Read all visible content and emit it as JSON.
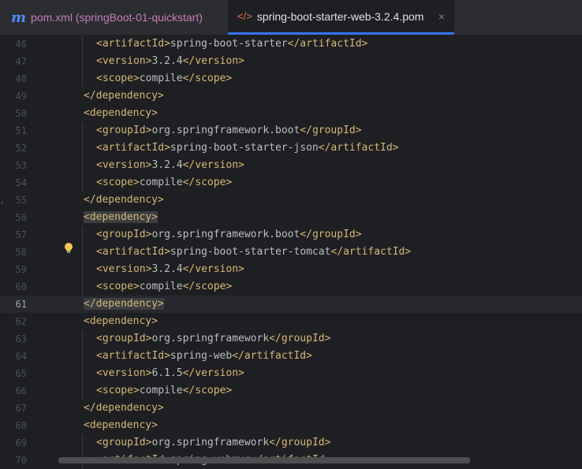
{
  "tabs": [
    {
      "label": "pom.xml (springBoot-01-quickstart)",
      "icon": "m-maven-icon",
      "active": false
    },
    {
      "label": "spring-boot-starter-web-3.2.4.pom",
      "icon": "xml-code-icon",
      "active": true
    }
  ],
  "tab_icons": {
    "maven": "m",
    "xml": "</>",
    "close": "×"
  },
  "editor": {
    "current_line": 61,
    "lines": [
      {
        "n": "46",
        "open": "<artifactId>",
        "text": "spring-boot-starter",
        "close": "</artifactId>"
      },
      {
        "n": "47",
        "open": "<version>",
        "text": "3.2.4",
        "close": "</version>"
      },
      {
        "n": "48",
        "open": "<scope>",
        "text": "compile",
        "close": "</scope>"
      },
      {
        "n": "49",
        "open": "",
        "text": "</dependency>",
        "close": ""
      },
      {
        "n": "50",
        "open": "",
        "text": "<dependency>",
        "close": ""
      },
      {
        "n": "51",
        "open": "<groupId>",
        "text": "org.springframework.boot",
        "close": "</groupId>"
      },
      {
        "n": "52",
        "open": "<artifactId>",
        "text": "spring-boot-starter-json",
        "close": "</artifactId>"
      },
      {
        "n": "53",
        "open": "<version>",
        "text": "3.2.4",
        "close": "</version>"
      },
      {
        "n": "54",
        "open": "<scope>",
        "text": "compile",
        "close": "</scope>"
      },
      {
        "n": "55",
        "open": "",
        "text": "</dependency>",
        "close": ""
      },
      {
        "n": "56",
        "open": "",
        "text": "<dependency>",
        "close": ""
      },
      {
        "n": "57",
        "open": "<groupId>",
        "text": "org.springframework.boot",
        "close": "</groupId>"
      },
      {
        "n": "58",
        "open": "<artifactId>",
        "text": "spring-boot-starter-tomcat",
        "close": "</artifactId>"
      },
      {
        "n": "59",
        "open": "<version>",
        "text": "3.2.4",
        "close": "</version>"
      },
      {
        "n": "60",
        "open": "<scope>",
        "text": "compile",
        "close": "</scope>"
      },
      {
        "n": "61",
        "open": "",
        "text": "</dependency>",
        "close": ""
      },
      {
        "n": "62",
        "open": "",
        "text": "<dependency>",
        "close": ""
      },
      {
        "n": "63",
        "open": "<groupId>",
        "text": "org.springframework",
        "close": "</groupId>"
      },
      {
        "n": "64",
        "open": "<artifactId>",
        "text": "spring-web",
        "close": "</artifactId>"
      },
      {
        "n": "65",
        "open": "<version>",
        "text": "6.1.5",
        "close": "</version>"
      },
      {
        "n": "66",
        "open": "<scope>",
        "text": "compile",
        "close": "</scope>"
      },
      {
        "n": "67",
        "open": "",
        "text": "</dependency>",
        "close": ""
      },
      {
        "n": "68",
        "open": "",
        "text": "<dependency>",
        "close": ""
      },
      {
        "n": "69",
        "open": "<groupId>",
        "text": "org.springframework",
        "close": "</groupId>"
      },
      {
        "n": "70",
        "open": "<artifactId>",
        "text": "spring-webmvc",
        "close": "</artifactId>"
      }
    ]
  },
  "colors": {
    "tag": "#d5b778",
    "text": "#bcbec4",
    "active_tab_underline": "#3574f0",
    "inactive_tab_text": "#c77dbb"
  }
}
